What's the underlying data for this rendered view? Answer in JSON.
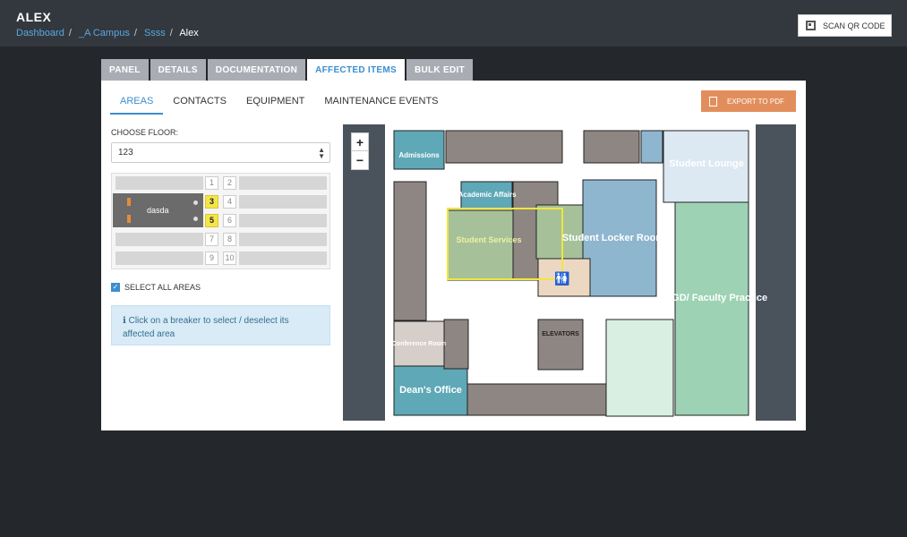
{
  "header": {
    "title": "ALEX",
    "breadcrumb": [
      "Dashboard",
      "_A Campus",
      "Ssss",
      "Alex"
    ],
    "qr_button": "SCAN QR CODE"
  },
  "tabs": [
    "PANEL",
    "DETAILS",
    "DOCUMENTATION",
    "AFFECTED ITEMS",
    "BULK EDIT"
  ],
  "active_tab": "AFFECTED ITEMS",
  "subtabs": [
    "AREAS",
    "CONTACTS",
    "EQUIPMENT",
    "MAINTENANCE EVENTS"
  ],
  "export_button": "EXPORT TO PDF",
  "floor": {
    "label": "CHOOSE FLOOR:",
    "value": "123"
  },
  "breakers": {
    "numbers": [
      "1",
      "2",
      "3",
      "4",
      "5",
      "6",
      "7",
      "8",
      "9",
      "10"
    ],
    "selected": [
      "3",
      "5"
    ],
    "circuit_label": "dasda"
  },
  "select_all": "SELECT ALL AREAS",
  "info_text": "Click on a breaker to select / deselect its affected area",
  "map": {
    "zoom_in": "+",
    "zoom_out": "−",
    "rooms": {
      "admissions": "Admissions",
      "academic_affairs": "Academic Affairs",
      "student_services": "Student Services",
      "student_locker": "Student Locker Rooms",
      "student_lounge": "Student Lounge",
      "aegd": "AEGD/ Faculty Practice",
      "conference": "Conference Room",
      "deans_office": "Dean's Office",
      "elevators": "ELEVATORS"
    }
  },
  "colors": {
    "accent": "#3a8fd1",
    "export": "#e28e5c",
    "selected_breaker": "#f4e64a"
  }
}
